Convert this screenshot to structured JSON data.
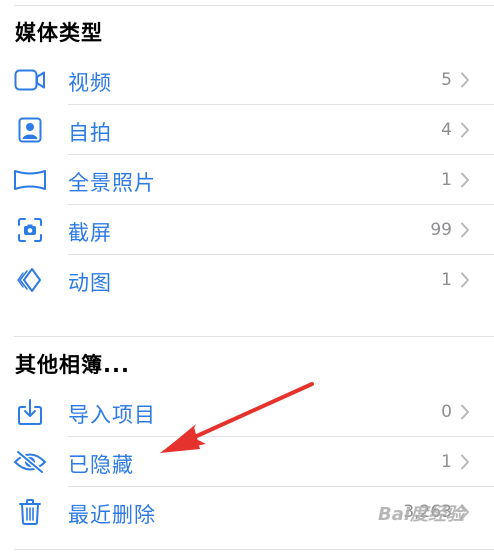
{
  "media_types": {
    "title": "媒体类型",
    "items": [
      {
        "label": "视频",
        "count": "5",
        "icon": "video-icon"
      },
      {
        "label": "自拍",
        "count": "4",
        "icon": "selfie-portrait-icon"
      },
      {
        "label": "全景照片",
        "count": "1",
        "icon": "panorama-icon"
      },
      {
        "label": "截屏",
        "count": "99",
        "icon": "screenshot-icon"
      },
      {
        "label": "动图",
        "count": "1",
        "icon": "live-photo-layers-icon"
      }
    ]
  },
  "other_albums": {
    "title": "其他相簿...",
    "items": [
      {
        "label": "导入项目",
        "count": "0",
        "icon": "import-icon"
      },
      {
        "label": "已隐藏",
        "count": "1",
        "icon": "hidden-eye-slash-icon"
      },
      {
        "label": "最近删除",
        "count": "3,263",
        "icon": "trash-icon"
      }
    ]
  },
  "colors": {
    "accent": "#2d7be5",
    "count_gray": "#8e8e93",
    "annotation_arrow": "#e5322d",
    "separator": "#e3e3e6"
  },
  "watermark": "Bai度经验"
}
